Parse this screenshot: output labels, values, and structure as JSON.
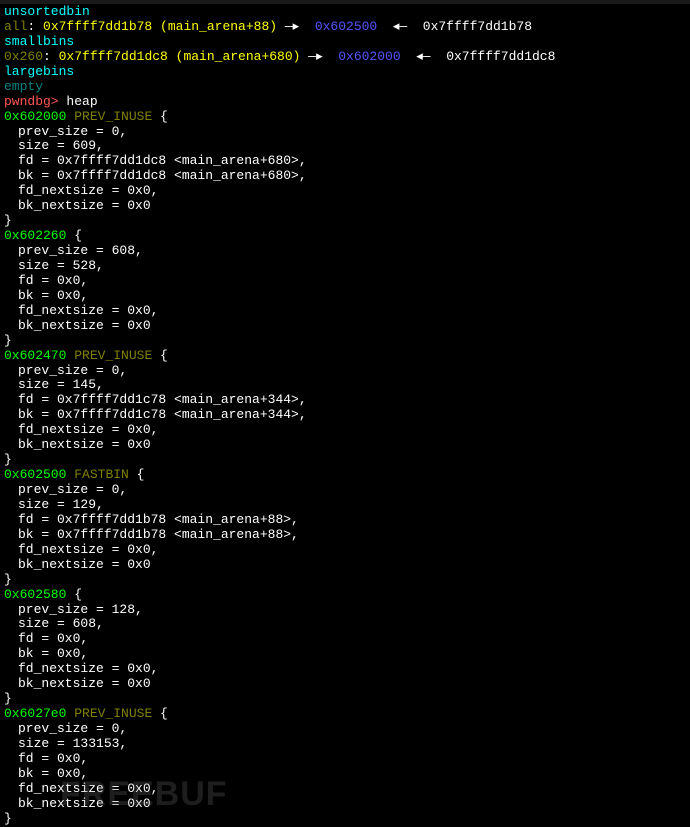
{
  "bins": {
    "unsorted": {
      "label": "unsortedbin",
      "tag": "all",
      "addr": "0x7ffff7dd1b78 (main_arena+88)",
      "arrow1": "—▸",
      "target": "0x602500",
      "arrow2": "◂—",
      "back": "0x7ffff7dd1b78"
    },
    "small": {
      "label": "smallbins",
      "tag": "0x260",
      "addr": "0x7ffff7dd1dc8 (main_arena+680)",
      "arrow1": "—▸",
      "target": "0x602000",
      "arrow2": "◂—",
      "back": "0x7ffff7dd1dc8"
    },
    "large": {
      "label": "largebins",
      "empty": "empty"
    }
  },
  "prompt": {
    "name": "pwndbg>",
    "cmd": " heap"
  },
  "chunks": [
    {
      "addr": "0x602000",
      "flag": "PREV_INUSE",
      "brace": " {",
      "fields": [
        "prev_size = 0,",
        "size = 609,",
        "fd = 0x7ffff7dd1dc8 <main_arena+680>,",
        "bk = 0x7ffff7dd1dc8 <main_arena+680>,",
        "fd_nextsize = 0x0,",
        "bk_nextsize = 0x0"
      ],
      "close": "}"
    },
    {
      "addr": "0x602260",
      "flag": "",
      "brace": " {",
      "fields": [
        "prev_size = 608,",
        "size = 528,",
        "fd = 0x0,",
        "bk = 0x0,",
        "fd_nextsize = 0x0,",
        "bk_nextsize = 0x0"
      ],
      "close": "}"
    },
    {
      "addr": "0x602470",
      "flag": "PREV_INUSE",
      "brace": " {",
      "fields": [
        "prev_size = 0,",
        "size = 145,",
        "fd = 0x7ffff7dd1c78 <main_arena+344>,",
        "bk = 0x7ffff7dd1c78 <main_arena+344>,",
        "fd_nextsize = 0x0,",
        "bk_nextsize = 0x0"
      ],
      "close": "}"
    },
    {
      "addr": "0x602500",
      "flag": "FASTBIN",
      "brace": " {",
      "fields": [
        "prev_size = 0,",
        "size = 129,",
        "fd = 0x7ffff7dd1b78 <main_arena+88>,",
        "bk = 0x7ffff7dd1b78 <main_arena+88>,",
        "fd_nextsize = 0x0,",
        "bk_nextsize = 0x0"
      ],
      "close": "}"
    },
    {
      "addr": "0x602580",
      "flag": "",
      "brace": " {",
      "fields": [
        "prev_size = 128,",
        "size = 608,",
        "fd = 0x0,",
        "bk = 0x0,",
        "fd_nextsize = 0x0,",
        "bk_nextsize = 0x0"
      ],
      "close": "}"
    },
    {
      "addr": "0x6027e0",
      "flag": "PREV_INUSE",
      "brace": " {",
      "fields": [
        "prev_size = 0,",
        "size = 133153,",
        "fd = 0x0,",
        "bk = 0x0,",
        "fd_nextsize = 0x0,",
        "bk_nextsize = 0x0"
      ],
      "close": "}"
    }
  ],
  "watermark": "FREEBUF",
  "colon": ": "
}
